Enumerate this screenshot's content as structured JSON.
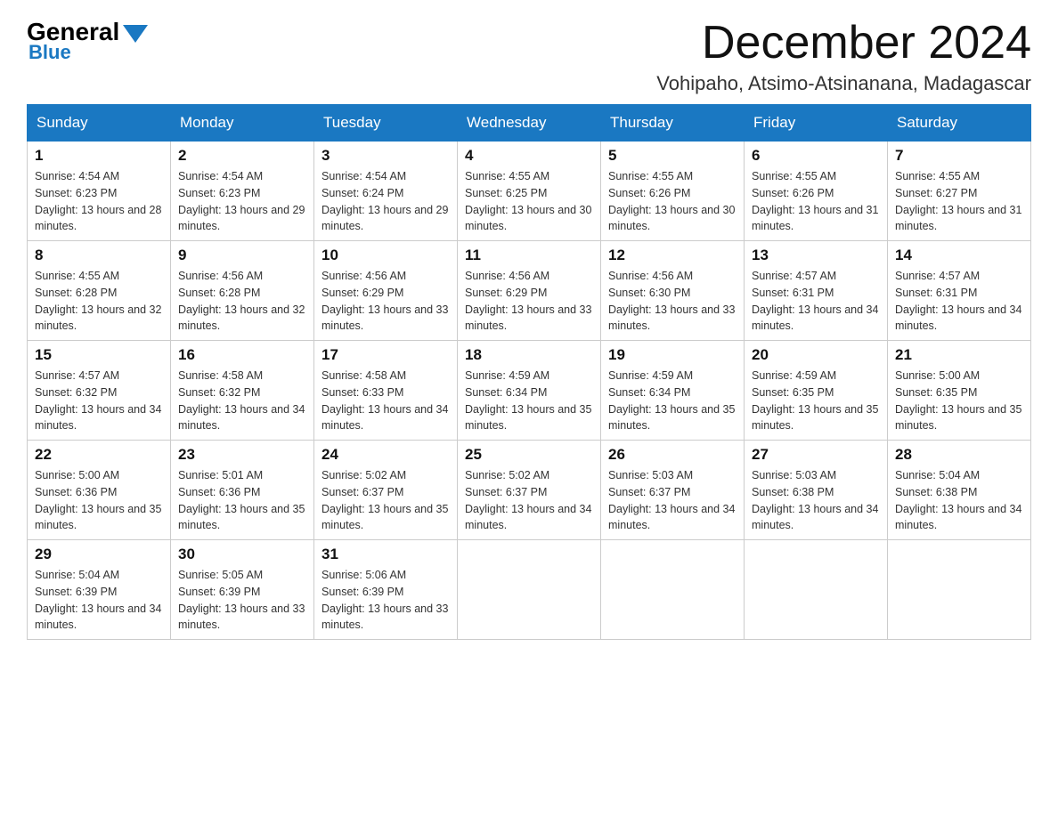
{
  "header": {
    "logo_general": "General",
    "logo_blue": "Blue",
    "month_title": "December 2024",
    "location": "Vohipaho, Atsimo-Atsinanana, Madagascar"
  },
  "days_of_week": [
    "Sunday",
    "Monday",
    "Tuesday",
    "Wednesday",
    "Thursday",
    "Friday",
    "Saturday"
  ],
  "weeks": [
    [
      {
        "day": 1,
        "sunrise": "4:54 AM",
        "sunset": "6:23 PM",
        "daylight": "13 hours and 28 minutes."
      },
      {
        "day": 2,
        "sunrise": "4:54 AM",
        "sunset": "6:23 PM",
        "daylight": "13 hours and 29 minutes."
      },
      {
        "day": 3,
        "sunrise": "4:54 AM",
        "sunset": "6:24 PM",
        "daylight": "13 hours and 29 minutes."
      },
      {
        "day": 4,
        "sunrise": "4:55 AM",
        "sunset": "6:25 PM",
        "daylight": "13 hours and 30 minutes."
      },
      {
        "day": 5,
        "sunrise": "4:55 AM",
        "sunset": "6:26 PM",
        "daylight": "13 hours and 30 minutes."
      },
      {
        "day": 6,
        "sunrise": "4:55 AM",
        "sunset": "6:26 PM",
        "daylight": "13 hours and 31 minutes."
      },
      {
        "day": 7,
        "sunrise": "4:55 AM",
        "sunset": "6:27 PM",
        "daylight": "13 hours and 31 minutes."
      }
    ],
    [
      {
        "day": 8,
        "sunrise": "4:55 AM",
        "sunset": "6:28 PM",
        "daylight": "13 hours and 32 minutes."
      },
      {
        "day": 9,
        "sunrise": "4:56 AM",
        "sunset": "6:28 PM",
        "daylight": "13 hours and 32 minutes."
      },
      {
        "day": 10,
        "sunrise": "4:56 AM",
        "sunset": "6:29 PM",
        "daylight": "13 hours and 33 minutes."
      },
      {
        "day": 11,
        "sunrise": "4:56 AM",
        "sunset": "6:29 PM",
        "daylight": "13 hours and 33 minutes."
      },
      {
        "day": 12,
        "sunrise": "4:56 AM",
        "sunset": "6:30 PM",
        "daylight": "13 hours and 33 minutes."
      },
      {
        "day": 13,
        "sunrise": "4:57 AM",
        "sunset": "6:31 PM",
        "daylight": "13 hours and 34 minutes."
      },
      {
        "day": 14,
        "sunrise": "4:57 AM",
        "sunset": "6:31 PM",
        "daylight": "13 hours and 34 minutes."
      }
    ],
    [
      {
        "day": 15,
        "sunrise": "4:57 AM",
        "sunset": "6:32 PM",
        "daylight": "13 hours and 34 minutes."
      },
      {
        "day": 16,
        "sunrise": "4:58 AM",
        "sunset": "6:32 PM",
        "daylight": "13 hours and 34 minutes."
      },
      {
        "day": 17,
        "sunrise": "4:58 AM",
        "sunset": "6:33 PM",
        "daylight": "13 hours and 34 minutes."
      },
      {
        "day": 18,
        "sunrise": "4:59 AM",
        "sunset": "6:34 PM",
        "daylight": "13 hours and 35 minutes."
      },
      {
        "day": 19,
        "sunrise": "4:59 AM",
        "sunset": "6:34 PM",
        "daylight": "13 hours and 35 minutes."
      },
      {
        "day": 20,
        "sunrise": "4:59 AM",
        "sunset": "6:35 PM",
        "daylight": "13 hours and 35 minutes."
      },
      {
        "day": 21,
        "sunrise": "5:00 AM",
        "sunset": "6:35 PM",
        "daylight": "13 hours and 35 minutes."
      }
    ],
    [
      {
        "day": 22,
        "sunrise": "5:00 AM",
        "sunset": "6:36 PM",
        "daylight": "13 hours and 35 minutes."
      },
      {
        "day": 23,
        "sunrise": "5:01 AM",
        "sunset": "6:36 PM",
        "daylight": "13 hours and 35 minutes."
      },
      {
        "day": 24,
        "sunrise": "5:02 AM",
        "sunset": "6:37 PM",
        "daylight": "13 hours and 35 minutes."
      },
      {
        "day": 25,
        "sunrise": "5:02 AM",
        "sunset": "6:37 PM",
        "daylight": "13 hours and 34 minutes."
      },
      {
        "day": 26,
        "sunrise": "5:03 AM",
        "sunset": "6:37 PM",
        "daylight": "13 hours and 34 minutes."
      },
      {
        "day": 27,
        "sunrise": "5:03 AM",
        "sunset": "6:38 PM",
        "daylight": "13 hours and 34 minutes."
      },
      {
        "day": 28,
        "sunrise": "5:04 AM",
        "sunset": "6:38 PM",
        "daylight": "13 hours and 34 minutes."
      }
    ],
    [
      {
        "day": 29,
        "sunrise": "5:04 AM",
        "sunset": "6:39 PM",
        "daylight": "13 hours and 34 minutes."
      },
      {
        "day": 30,
        "sunrise": "5:05 AM",
        "sunset": "6:39 PM",
        "daylight": "13 hours and 33 minutes."
      },
      {
        "day": 31,
        "sunrise": "5:06 AM",
        "sunset": "6:39 PM",
        "daylight": "13 hours and 33 minutes."
      },
      null,
      null,
      null,
      null
    ]
  ]
}
